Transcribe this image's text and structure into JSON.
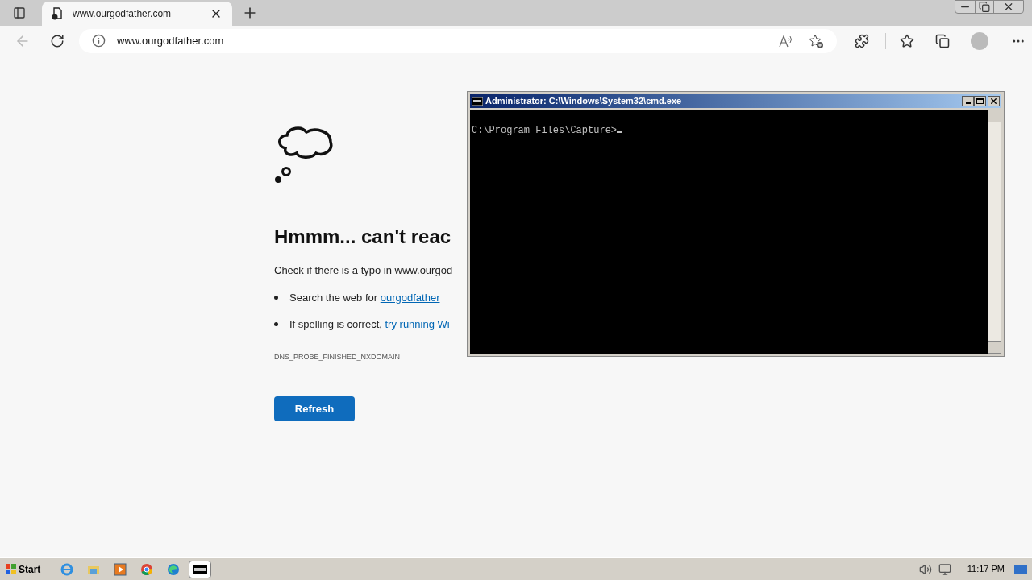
{
  "browser": {
    "tab": {
      "title": "www.ourgodfather.com"
    },
    "address_bar": {
      "url": "www.ourgodfather.com"
    }
  },
  "page": {
    "heading": "Hmmm... can't reac",
    "description": "Check if there is a typo in www.ourgod",
    "suggestions": [
      {
        "text": "Search the web for ",
        "link": "ourgodfather"
      },
      {
        "text": "If spelling is correct, ",
        "link": "try running Wi"
      }
    ],
    "error_code": "DNS_PROBE_FINISHED_NXDOMAIN",
    "refresh_button": "Refresh"
  },
  "cmd_window": {
    "title": "Administrator: C:\\Windows\\System32\\cmd.exe",
    "prompt": "C:\\Program Files\\Capture>"
  },
  "taskbar": {
    "start": "Start",
    "apps": [
      {
        "kind": "ie",
        "selected": false
      },
      {
        "kind": "folder",
        "selected": false
      },
      {
        "kind": "media",
        "selected": false
      },
      {
        "kind": "chrome",
        "selected": false
      },
      {
        "kind": "edge",
        "selected": false
      },
      {
        "kind": "console",
        "selected": true
      }
    ],
    "clock": "11:17 PM"
  }
}
